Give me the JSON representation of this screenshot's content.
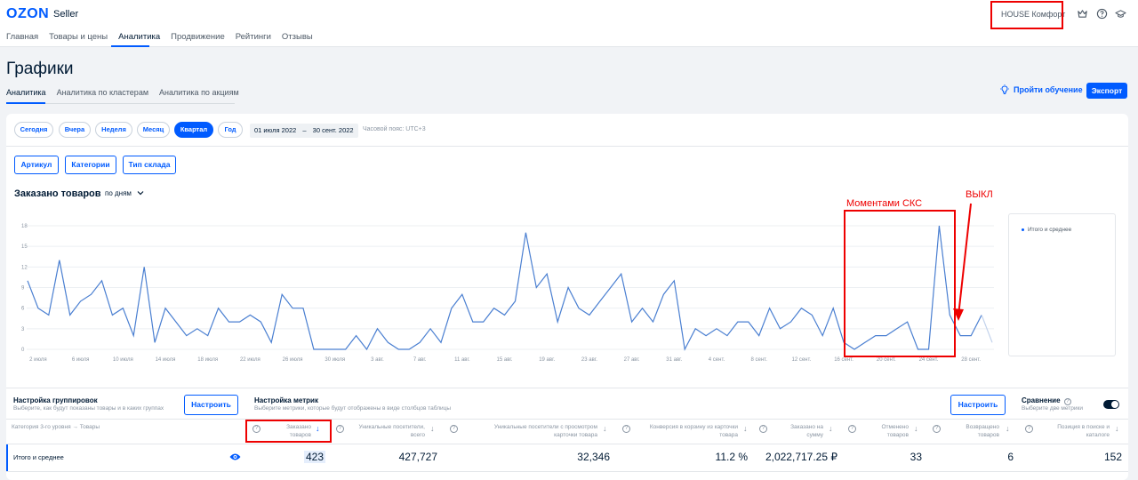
{
  "header": {
    "logo": "OZON",
    "logo_suffix": "Seller",
    "nav": [
      "Главная",
      "Товары и цены",
      "Аналитика",
      "Продвижение",
      "Рейтинги",
      "Отзывы"
    ],
    "company": "HOUSE Комфорт",
    "icons": [
      "crown-icon",
      "help-icon",
      "graduation-cap-icon"
    ]
  },
  "page": {
    "title": "Графики",
    "tabs": [
      "Аналитика",
      "Аналитика по кластерам",
      "Аналитика по акциям"
    ],
    "learn_label": "Пройти обучение",
    "export_label": "Экспорт"
  },
  "filters": {
    "periods": [
      "Сегодня",
      "Вчера",
      "Неделя",
      "Месяц",
      "Квартал",
      "Год"
    ],
    "active_period": "Квартал",
    "date_from": "01 июля 2022",
    "date_sep": "–",
    "date_to": "30 сент. 2022",
    "timezone": "Часовой пояс: UTC+3",
    "buttons": [
      "Артикул",
      "Категории",
      "Тип склада"
    ]
  },
  "chart": {
    "title": "Заказано товаров",
    "period": "по дням",
    "legend": "Итого и среднее",
    "annotation_skc": "Моментами СКС",
    "annotation_off": "ВЫКЛ"
  },
  "chart_data": {
    "type": "line",
    "ylim": [
      0,
      18
    ],
    "yticks": [
      0,
      3,
      6,
      9,
      12,
      15,
      18
    ],
    "xtick_labels": [
      "2 июля",
      "6 июля",
      "10 июля",
      "14 июля",
      "18 июля",
      "22 июля",
      "26 июля",
      "30 июля",
      "3 авг.",
      "7 авг.",
      "11 авг.",
      "15 авг.",
      "19 авг.",
      "23 авг.",
      "27 авг.",
      "31 авг.",
      "4 сент.",
      "8 сент.",
      "12 сент.",
      "16 сент.",
      "20 сент.",
      "24 сент.",
      "28 сент."
    ],
    "series": [
      {
        "name": "Итого и среднее",
        "color": "#4a7fd1",
        "values": [
          10,
          6,
          5,
          13,
          5,
          7,
          8,
          10,
          5,
          6,
          2,
          12,
          1,
          6,
          4,
          2,
          3,
          2,
          6,
          4,
          4,
          5,
          4,
          1,
          8,
          6,
          6,
          0,
          0,
          0,
          0,
          2,
          0,
          3,
          1,
          0,
          0,
          1,
          3,
          1,
          6,
          8,
          4,
          4,
          6,
          5,
          7,
          17,
          9,
          11,
          4,
          9,
          6,
          5,
          7,
          9,
          11,
          4,
          6,
          4,
          8,
          10,
          0,
          3,
          2,
          3,
          2,
          4,
          4,
          2,
          6,
          3,
          4,
          6,
          5,
          2,
          6,
          1,
          0,
          1,
          2,
          2,
          3,
          4,
          0,
          0,
          18,
          5,
          2,
          2,
          5,
          1
        ]
      }
    ],
    "grid": true
  },
  "table_config": {
    "grouping_title": "Настройка группировок",
    "grouping_sub": "Выберите, как будут показаны товары и в каких группах",
    "grouping_button": "Настроить",
    "metrics_title": "Настройка метрик",
    "metrics_sub": "Выберите метрики, которые будут отображены в виде столбцов таблицы",
    "metrics_button": "Настроить",
    "compare_title": "Сравнение",
    "compare_sub": "Выберите две метрики"
  },
  "table": {
    "headers": {
      "category": "Категория 3-го уровня → Товары",
      "ordered": "Заказано товаров",
      "visitors": "Уникальные посетители, всего",
      "visitors_card": "Уникальные посетители с просмотром карточки товара",
      "conversion": "Конверсия в корзину из карточки товара",
      "ordered_sum": "Заказано на сумму",
      "cancelled": "Отменено товаров",
      "returned": "Возвращено товаров",
      "position": "Позиция в поиске и каталоге"
    },
    "row": {
      "category": "Итого и среднее",
      "ordered": "423",
      "visitors": "427,727",
      "visitors_card": "32,346",
      "conversion": "11.2 %",
      "ordered_sum": "2,022,717.25 ₽",
      "cancelled": "33",
      "returned": "6",
      "position": "152"
    }
  }
}
